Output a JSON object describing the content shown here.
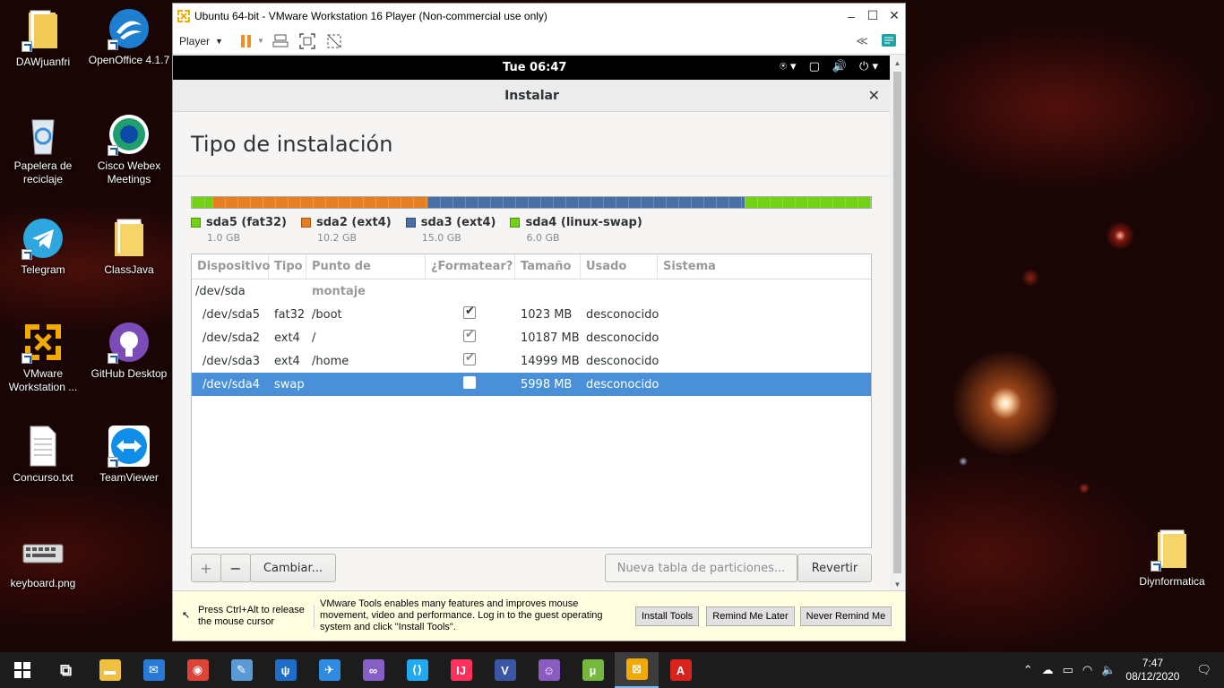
{
  "desktop": {
    "icons": [
      {
        "label": "DAWjuanfri",
        "icon": "folder-icon"
      },
      {
        "label": "OpenOffice 4.1.7",
        "icon": "openoffice-icon"
      },
      {
        "label": "Papelera de reciclaje",
        "icon": "recycle-bin-icon"
      },
      {
        "label": "Cisco Webex Meetings",
        "icon": "webex-icon"
      },
      {
        "label": "Telegram",
        "icon": "telegram-icon"
      },
      {
        "label": "ClassJava",
        "icon": "folder-icon"
      },
      {
        "label": "VMware Workstation ...",
        "icon": "vmware-icon"
      },
      {
        "label": "GitHub Desktop",
        "icon": "github-icon"
      },
      {
        "label": "Concurso.txt",
        "icon": "text-file-icon"
      },
      {
        "label": "TeamViewer",
        "icon": "teamviewer-icon"
      },
      {
        "label": "keyboard.png",
        "icon": "image-file-icon"
      },
      {
        "label": "Diynformatica",
        "icon": "folder-icon"
      }
    ]
  },
  "vmware": {
    "title": "Ubuntu 64-bit - VMware Workstation 16 Player (Non-commercial use only)",
    "player_menu": "Player",
    "guest_topbar": {
      "clock": "Tue 06:47"
    },
    "installer": {
      "window_title": "Instalar",
      "step_title": "Tipo de instalación",
      "partitions_bar": [
        {
          "name": "sda5 (fat32)",
          "size": "1.0 GB",
          "color": "#73d216",
          "fraction": 0.03
        },
        {
          "name": "sda2 (ext4)",
          "size": "10.2 GB",
          "color": "#e67e22",
          "fraction": 0.317
        },
        {
          "name": "sda3 (ext4)",
          "size": "15.0 GB",
          "color": "#4a6fa5",
          "fraction": 0.467
        },
        {
          "name": "sda4 (linux-swap)",
          "size": "6.0 GB",
          "color": "#73d216",
          "fraction": 0.186
        }
      ],
      "table": {
        "headers": [
          "Dispositivo",
          "Tipo",
          "Punto de montaje",
          "¿Formatear?",
          "Tamaño",
          "Usado",
          "Sistema"
        ],
        "disk": "/dev/sda",
        "rows": [
          {
            "device": "/dev/sda5",
            "type": "fat32",
            "mount": "/boot",
            "format": "checked",
            "size": "1023 MB",
            "used": "desconocido",
            "system": ""
          },
          {
            "device": "/dev/sda2",
            "type": "ext4",
            "mount": "/",
            "format": "checked-dim",
            "size": "10187 MB",
            "used": "desconocido",
            "system": ""
          },
          {
            "device": "/dev/sda3",
            "type": "ext4",
            "mount": "/home",
            "format": "checked-dim",
            "size": "14999 MB",
            "used": "desconocido",
            "system": ""
          },
          {
            "device": "/dev/sda4",
            "type": "swap",
            "mount": "",
            "format": "unchecked",
            "size": "5998 MB",
            "used": "desconocido",
            "system": "",
            "selected": true
          }
        ]
      },
      "buttons": {
        "add": "+",
        "remove": "−",
        "change": "Cambiar...",
        "new_table": "Nueva tabla de particiones...",
        "revert": "Revertir"
      }
    },
    "tools_bar": {
      "hint": "Press Ctrl+Alt to release the mouse cursor",
      "message": "VMware Tools enables many features and improves mouse movement, video and performance. Log in to the guest operating system and click \"Install Tools\".",
      "install": "Install Tools",
      "remind_later": "Remind Me Later",
      "never_remind": "Never Remind Me"
    }
  },
  "taskbar": {
    "apps": [
      {
        "name": "task-view-icon"
      },
      {
        "name": "file-explorer-icon",
        "color": "#f0c040"
      },
      {
        "name": "mail-icon",
        "color": "#2a7ad5"
      },
      {
        "name": "chrome-icon",
        "color": "#db4437"
      },
      {
        "name": "paint-icon",
        "color": "#5a9bd5"
      },
      {
        "name": "sourcetree-icon",
        "color": "#1e6ec8"
      },
      {
        "name": "thunderbird-icon",
        "color": "#2f8be0"
      },
      {
        "name": "visual-studio-icon",
        "color": "#865fc5"
      },
      {
        "name": "vscode-icon",
        "color": "#23a9f2"
      },
      {
        "name": "intellij-icon",
        "color": "#fe315d"
      },
      {
        "name": "visio-icon",
        "color": "#3955a3"
      },
      {
        "name": "github-desktop-icon",
        "color": "#8a5cc2"
      },
      {
        "name": "utorrent-icon",
        "color": "#76b83f"
      },
      {
        "name": "vmware-icon",
        "color": "#f2a900",
        "active": true
      },
      {
        "name": "acrobat-icon",
        "color": "#d8221c"
      }
    ],
    "time": "7:47",
    "date": "08/12/2020"
  }
}
